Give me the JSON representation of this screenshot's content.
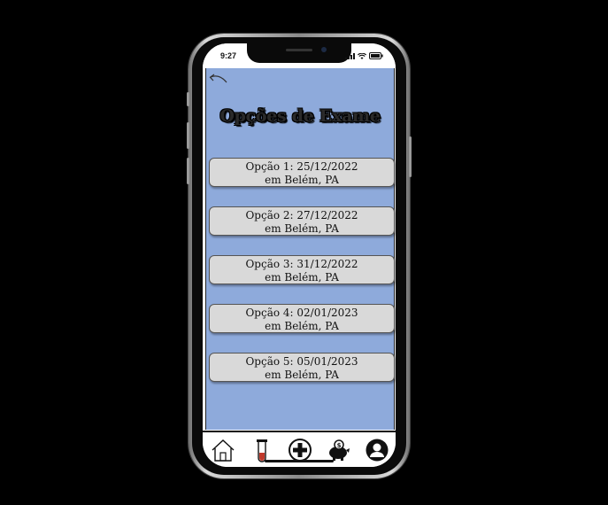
{
  "status": {
    "time": "9:27"
  },
  "header": {
    "title": "Opções de Exame"
  },
  "options": [
    {
      "line1": "Opção 1: 25/12/2022",
      "line2": "em Belém, PA"
    },
    {
      "line1": "Opção 2: 27/12/2022",
      "line2": "em Belém, PA"
    },
    {
      "line1": "Opção 3: 31/12/2022",
      "line2": "em Belém, PA"
    },
    {
      "line1": "Opção 4: 02/01/2023",
      "line2": "em Belém, PA"
    },
    {
      "line1": "Opção 5: 05/01/2023",
      "line2": "em Belém, PA"
    }
  ],
  "tabbar": {
    "icons": [
      "home-icon",
      "test-tube-icon",
      "medical-plus-icon",
      "piggy-bank-icon",
      "profile-icon"
    ]
  },
  "colors": {
    "background": "#8eaadb",
    "option_bg": "#d9d9d9",
    "page_bg": "#000000"
  }
}
